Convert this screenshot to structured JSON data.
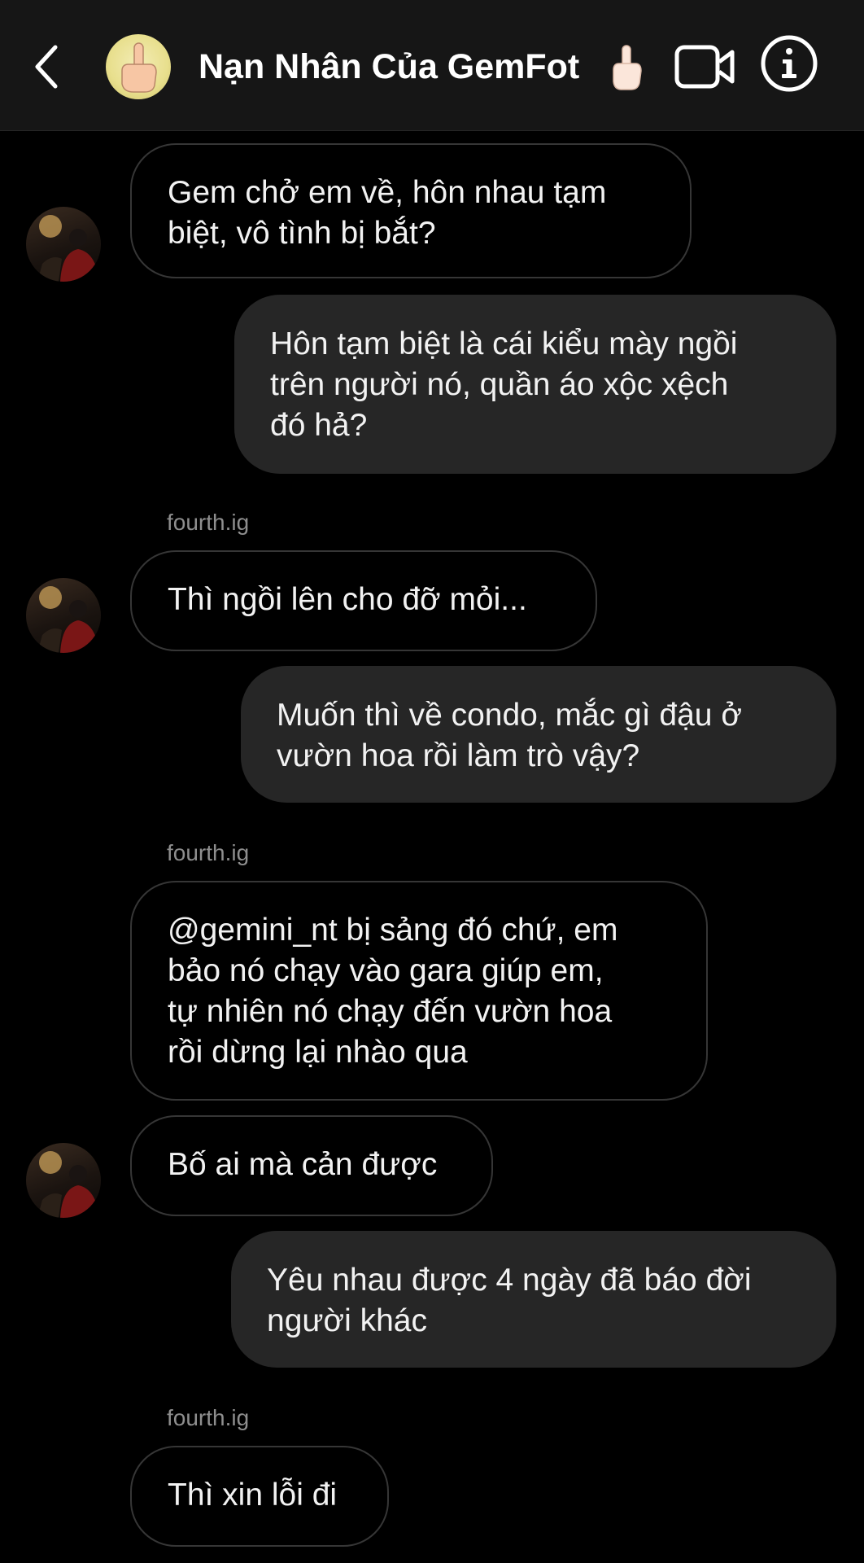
{
  "header": {
    "title": "Nạn Nhân Của GemFot",
    "back_icon": "chevron-left-icon",
    "video_icon": "video-camera-icon",
    "info_icon": "info-icon"
  },
  "messages": [
    {
      "side": "in",
      "text": "Gem chở em về, hôn nhau tạm\nbiệt, vô tình bị bắt?"
    },
    {
      "side": "out",
      "text": "Hôn tạm biệt là cái kiểu mày ngồi\ntrên người nó, quần áo xộc xệch\nđó hả?"
    },
    {
      "side": "sender",
      "text": "fourth.ig"
    },
    {
      "side": "in",
      "text": "Thì ngồi lên cho đỡ mỏi..."
    },
    {
      "side": "out",
      "text": "Muốn thì về condo, mắc gì đậu ở\nvườn hoa rồi làm trò vậy?"
    },
    {
      "side": "sender",
      "text": "fourth.ig"
    },
    {
      "side": "in",
      "text": "@gemini_nt bị sảng đó chứ, em\nbảo nó chạy vào gara giúp em,\ntự nhiên nó chạy đến vườn hoa\nrồi dừng lại nhào qua"
    },
    {
      "side": "in",
      "text": "Bố ai mà cản được"
    },
    {
      "side": "out",
      "text": "Yêu nhau được 4 ngày đã báo đời\nngười khác"
    },
    {
      "side": "sender",
      "text": "fourth.ig"
    },
    {
      "side": "in",
      "text": "Thì xin lỗi đi"
    }
  ],
  "colors": {
    "background": "#000000",
    "header": "#161616",
    "outgoing_bubble": "#262626",
    "incoming_border": "#363636",
    "sender_label": "#8e8e8e"
  }
}
